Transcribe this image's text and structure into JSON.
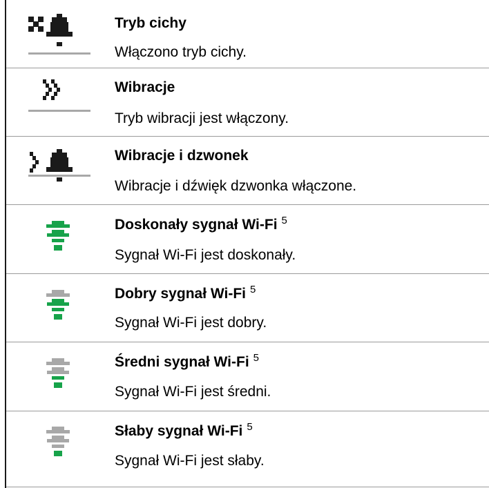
{
  "rows": [
    {
      "icon": "silent-mode-icon",
      "title": "Tryb cichy",
      "sup": "",
      "desc": "Włączono tryb cichy."
    },
    {
      "icon": "vibrate-icon",
      "title": "Wibracje",
      "sup": "",
      "desc": "Tryb wibracji jest włączony."
    },
    {
      "icon": "vibrate-and-ring-icon",
      "title": "Wibracje i dzwonek",
      "sup": "",
      "desc": "Wibracje i dźwięk dzwonka włączone."
    },
    {
      "icon": "wifi-excellent-icon",
      "title": "Doskonały sygnał Wi-Fi",
      "sup": "5",
      "desc": "Sygnał Wi-Fi jest doskonały."
    },
    {
      "icon": "wifi-good-icon",
      "title": "Dobry sygnał Wi-Fi",
      "sup": "5",
      "desc": "Sygnał Wi-Fi jest dobry."
    },
    {
      "icon": "wifi-medium-icon",
      "title": "Średni sygnał Wi-Fi",
      "sup": "5",
      "desc": "Sygnał Wi-Fi jest średni."
    },
    {
      "icon": "wifi-weak-icon",
      "title": "Słaby sygnał Wi-Fi",
      "sup": "5",
      "desc": "Sygnał Wi-Fi jest słaby."
    }
  ],
  "colors": {
    "icon_dark": "#1a1a1a",
    "icon_grey": "#a8a8a8",
    "wifi_green": "#17a34a",
    "divider": "#9a9a9a"
  }
}
